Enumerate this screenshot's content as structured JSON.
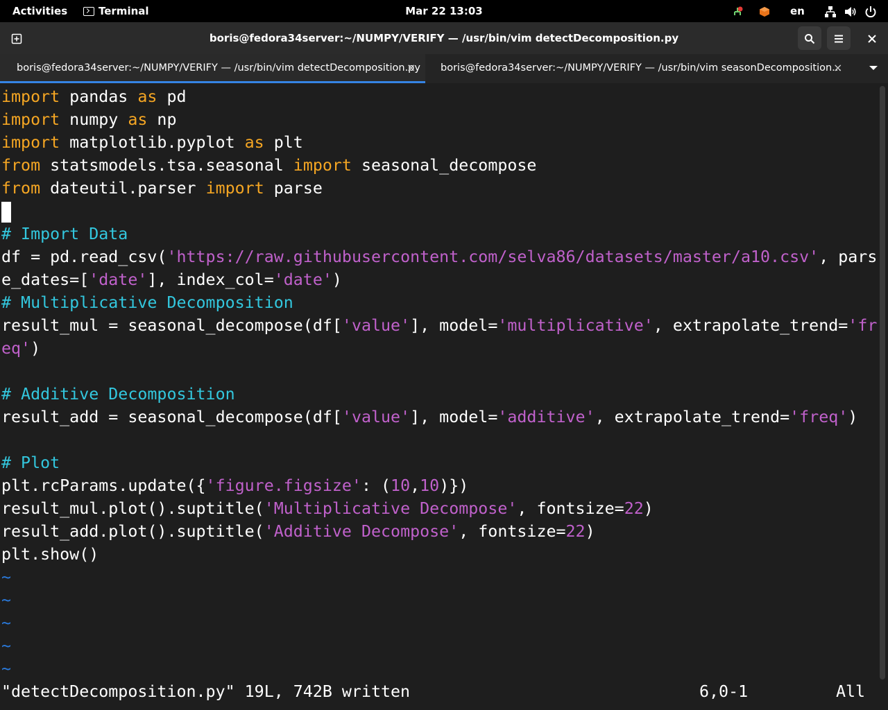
{
  "topbar": {
    "activities": "Activities",
    "app_name": "Terminal",
    "clock": "Mar 22  13:03",
    "lang": "en",
    "tray_icons": [
      "network-warning-icon",
      "package-icon",
      "network-wired-icon",
      "volume-icon",
      "power-icon"
    ]
  },
  "window": {
    "title": "boris@fedora34server:~/NUMPY/VERIFY — /usr/bin/vim detectDecomposition.py",
    "tabs": [
      {
        "label": "boris@fedora34server:~/NUMPY/VERIFY — /usr/bin/vim detectDecomposition.py",
        "close": "×"
      },
      {
        "label": "boris@fedora34server:~/NUMPY/VERIFY — /usr/bin/vim seasonDecomposition...",
        "close": "×"
      }
    ]
  },
  "code": {
    "l1": {
      "a": "import",
      "b": " pandas ",
      "c": "as",
      "d": " pd"
    },
    "l2": {
      "a": "import",
      "b": " numpy ",
      "c": "as",
      "d": " np"
    },
    "l3": {
      "a": "import",
      "b": " matplotlib.pyplot ",
      "c": "as",
      "d": " plt"
    },
    "l4": {
      "a": "from",
      "b": " statsmodels.tsa.seasonal ",
      "c": "import",
      "d": " seasonal_decompose"
    },
    "l5": {
      "a": "from",
      "b": " dateutil.parser ",
      "c": "import",
      "d": " parse"
    },
    "l7": "# Import Data",
    "l8": {
      "a": "df = pd.read_csv(",
      "b": "'https://raw.githubusercontent.com/selva86/datasets/master/a10.csv'",
      "c": ", pars"
    },
    "l9": {
      "a": "e_dates=[",
      "b": "'date'",
      "c": "], index_col=",
      "d": "'date'",
      "e": ")"
    },
    "l10": "# Multiplicative Decomposition",
    "l11": {
      "a": "result_mul = seasonal_decompose(df[",
      "b": "'value'",
      "c": "], model=",
      "d": "'multiplicative'",
      "e": ", extrapolate_trend=",
      "f": "'fr"
    },
    "l12": {
      "a": "eq'",
      "b": ")"
    },
    "l14": "# Additive Decomposition",
    "l15": {
      "a": "result_add = seasonal_decompose(df[",
      "b": "'value'",
      "c": "], model=",
      "d": "'additive'",
      "e": ", extrapolate_trend=",
      "f": "'freq'",
      "g": ")"
    },
    "l17": "# Plot",
    "l18": {
      "a": "plt.rcParams.update({",
      "b": "'figure.figsize'",
      "c": ": (",
      "d": "10",
      "e": ",",
      "f": "10",
      "g": ")})"
    },
    "l19": {
      "a": "result_mul.plot().suptitle(",
      "b": "'Multiplicative Decompose'",
      "c": ", fontsize=",
      "d": "22",
      "e": ")"
    },
    "l20": {
      "a": "result_add.plot().suptitle(",
      "b": "'Additive Decompose'",
      "c": ", fontsize=",
      "d": "22",
      "e": ")"
    },
    "l21": "plt.show()",
    "tilde": "~"
  },
  "status": {
    "message": "\"detectDecomposition.py\" 19L, 742B written",
    "position": "6,0-1",
    "scroll": "All"
  }
}
